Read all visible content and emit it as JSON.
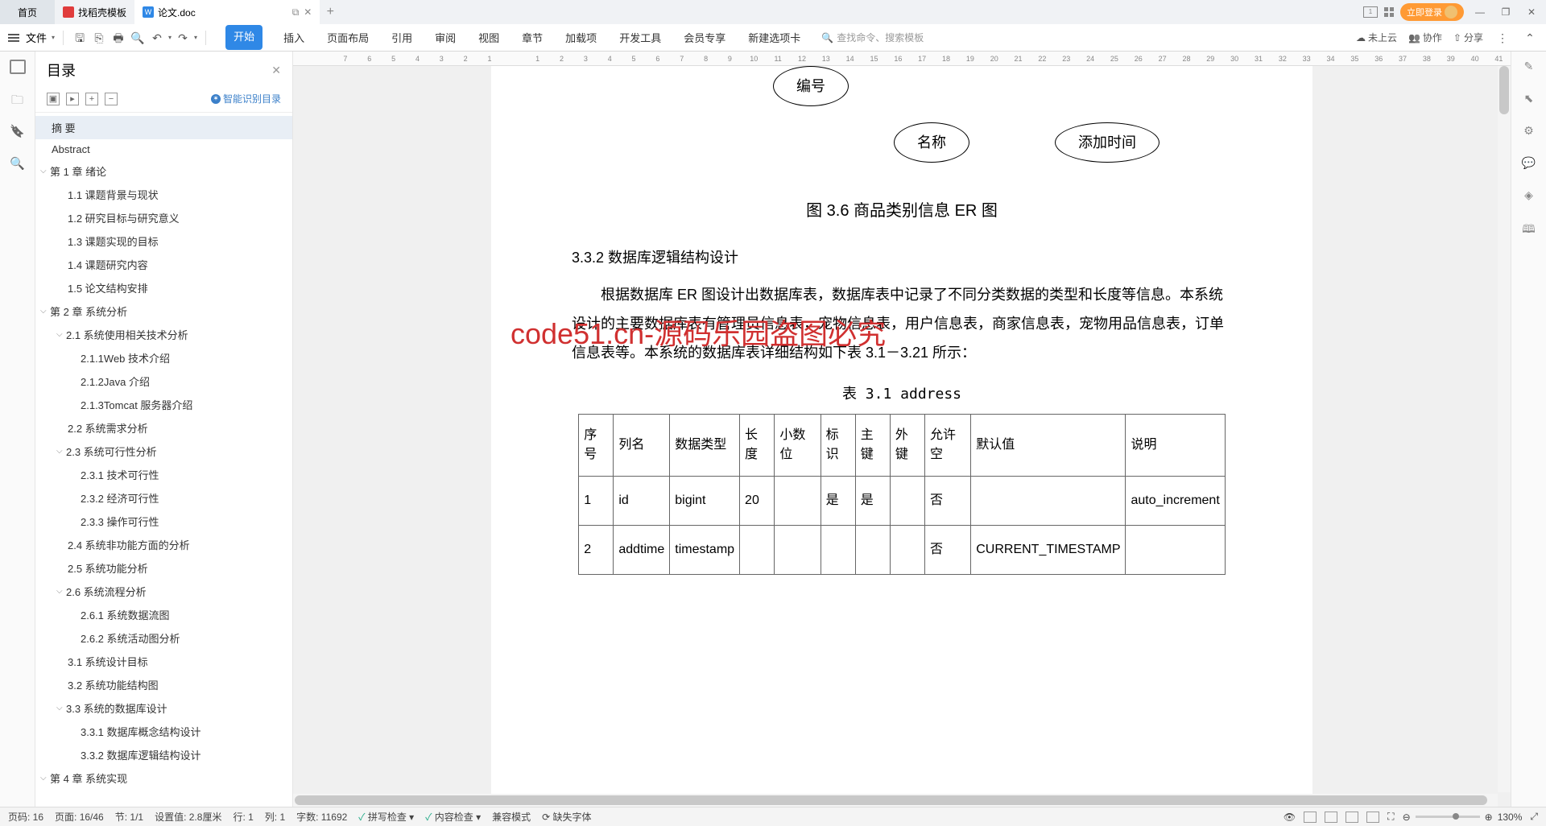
{
  "tabs": {
    "home": "首页",
    "template": "找稻壳模板",
    "doc": "论文.doc"
  },
  "login": "立即登录",
  "file_label": "文件",
  "ribbon": [
    "开始",
    "插入",
    "页面布局",
    "引用",
    "审阅",
    "视图",
    "章节",
    "加载项",
    "开发工具",
    "会员专享",
    "新建选项卡"
  ],
  "search_ph": "查找命令、搜索模板",
  "rtools": {
    "cloud": "未上云",
    "collab": "协作",
    "share": "分享"
  },
  "outline": {
    "title": "目录",
    "smart": "智能识别目录",
    "items": [
      {
        "t": "摘 要",
        "lv": 1,
        "sel": true
      },
      {
        "t": "Abstract",
        "lv": 1
      },
      {
        "t": "第 1 章  绪论",
        "lv": 1,
        "exp": true
      },
      {
        "t": "1.1 课题背景与现状",
        "lv": 2
      },
      {
        "t": "1.2 研究目标与研究意义",
        "lv": 2
      },
      {
        "t": "1.3 课题实现的目标",
        "lv": 2
      },
      {
        "t": "1.4 课题研究内容",
        "lv": 2
      },
      {
        "t": "1.5 论文结构安排",
        "lv": 2
      },
      {
        "t": "第 2 章  系统分析",
        "lv": 1,
        "exp": true
      },
      {
        "t": "2.1 系统使用相关技术分析",
        "lv": 2,
        "exp": true
      },
      {
        "t": "2.1.1Web 技术介绍",
        "lv": 3
      },
      {
        "t": "2.1.2Java 介绍",
        "lv": 3
      },
      {
        "t": "2.1.3Tomcat 服务器介绍",
        "lv": 3
      },
      {
        "t": "2.2 系统需求分析",
        "lv": 2
      },
      {
        "t": "2.3 系统可行性分析",
        "lv": 2,
        "exp": true
      },
      {
        "t": "2.3.1 技术可行性",
        "lv": 3
      },
      {
        "t": "2.3.2 经济可行性",
        "lv": 3
      },
      {
        "t": "2.3.3 操作可行性",
        "lv": 3
      },
      {
        "t": "2.4 系统非功能方面的分析",
        "lv": 2
      },
      {
        "t": "2.5 系统功能分析",
        "lv": 2
      },
      {
        "t": "2.6 系统流程分析",
        "lv": 2,
        "exp": true
      },
      {
        "t": "2.6.1 系统数据流图",
        "lv": 3
      },
      {
        "t": "2.6.2 系统活动图分析",
        "lv": 3
      },
      {
        "t": "3.1 系统设计目标",
        "lv": 2
      },
      {
        "t": "3.2 系统功能结构图",
        "lv": 2
      },
      {
        "t": "3.3 系统的数据库设计",
        "lv": 2,
        "exp": true
      },
      {
        "t": "3.3.1 数据库概念结构设计",
        "lv": 3
      },
      {
        "t": "3.3.2 数据库逻辑结构设计",
        "lv": 3
      },
      {
        "t": "第 4 章  系统实现",
        "lv": 1,
        "exp": true
      }
    ]
  },
  "ruler": [
    "7",
    "6",
    "5",
    "4",
    "3",
    "2",
    "1",
    "",
    "1",
    "2",
    "3",
    "4",
    "5",
    "6",
    "7",
    "8",
    "9",
    "10",
    "11",
    "12",
    "13",
    "14",
    "15",
    "16",
    "17",
    "18",
    "19",
    "20",
    "21",
    "22",
    "23",
    "24",
    "25",
    "26",
    "27",
    "28",
    "29",
    "30",
    "31",
    "32",
    "33",
    "34",
    "35",
    "36",
    "37",
    "38",
    "39",
    "40",
    "41"
  ],
  "doc": {
    "el1": "编号",
    "el2": "名称",
    "el3": "添加时间",
    "fig_cap": "图 3.6 商品类别信息 ER 图",
    "h332": "3.3.2 数据库逻辑结构设计",
    "p1": "根据数据库 ER 图设计出数据库表，数据库表中记录了不同分类数据的类型和长度等信息。本系统设计的主要数据库表有管理员信息表，宠物信息表，用户信息表，商家信息表，宠物用品信息表，订单信息表等。本系统的数据库表详细结构如下表 3.1－3.21 所示：",
    "wm": "code51.cn-源码乐园盗图必究",
    "tbl_cap": "表 3.1  address",
    "tbl_head": [
      "序号",
      "列名",
      "数据类型",
      "长度",
      "小数位",
      "标识",
      "主键",
      "外键",
      "允许空",
      "默认值",
      "说明"
    ],
    "tbl_rows": [
      [
        "1",
        "id",
        "bigint",
        "20",
        "",
        "是",
        "是",
        "",
        "否",
        "",
        "auto_increment"
      ],
      [
        "2",
        "addtime",
        "timestamp",
        "",
        "",
        "",
        "",
        "",
        "否",
        "CURRENT_TIMESTAMP",
        ""
      ]
    ]
  },
  "status": {
    "page": "页码: 16",
    "pages": "页面: 16/46",
    "sec": "节: 1/1",
    "setval": "设置值: 2.8厘米",
    "row": "行: 1",
    "col": "列: 1",
    "wc": "字数: 11692",
    "spell": "拼写检查",
    "content": "内容检查",
    "compat": "兼容模式",
    "font": "缺失字体",
    "zoom": "130%"
  }
}
